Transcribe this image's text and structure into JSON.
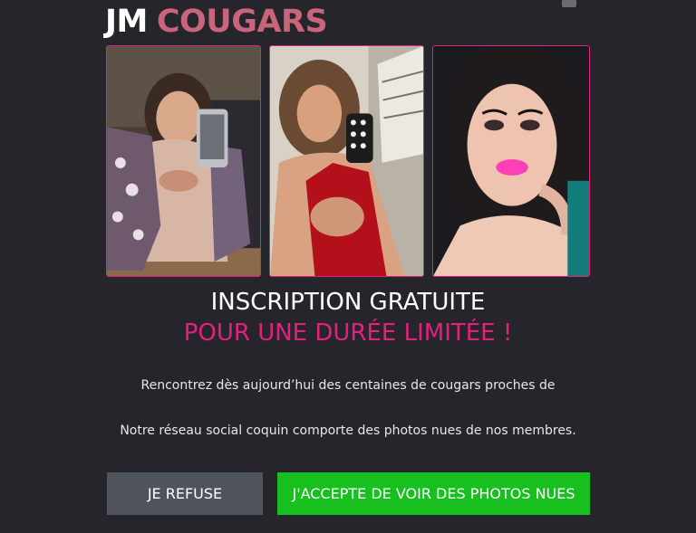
{
  "brand": {
    "part1": "JM",
    "part2": "COUGARS",
    "accent_color": "#c9647a"
  },
  "header": {
    "user_icon": "user-icon"
  },
  "photos": [
    {
      "label": "profile-photo-1"
    },
    {
      "label": "profile-photo-2"
    },
    {
      "label": "profile-photo-3"
    }
  ],
  "headline": {
    "line1": "INSCRIPTION GRATUITE",
    "line2": "POUR UNE DURÉE LIMITÉE !",
    "highlight_color": "#e4207c"
  },
  "body": {
    "line1": "Rencontrez dès aujourd’hui des centaines de cougars proches de",
    "line2": "Notre réseau social coquin comporte des photos nues de nos membres."
  },
  "buttons": {
    "refuse_label": "JE REFUSE",
    "accept_label": "J'ACCEPTE DE VOIR DES PHOTOS NUES",
    "refuse_color": "#4f535c",
    "accept_color": "#17c01e"
  }
}
